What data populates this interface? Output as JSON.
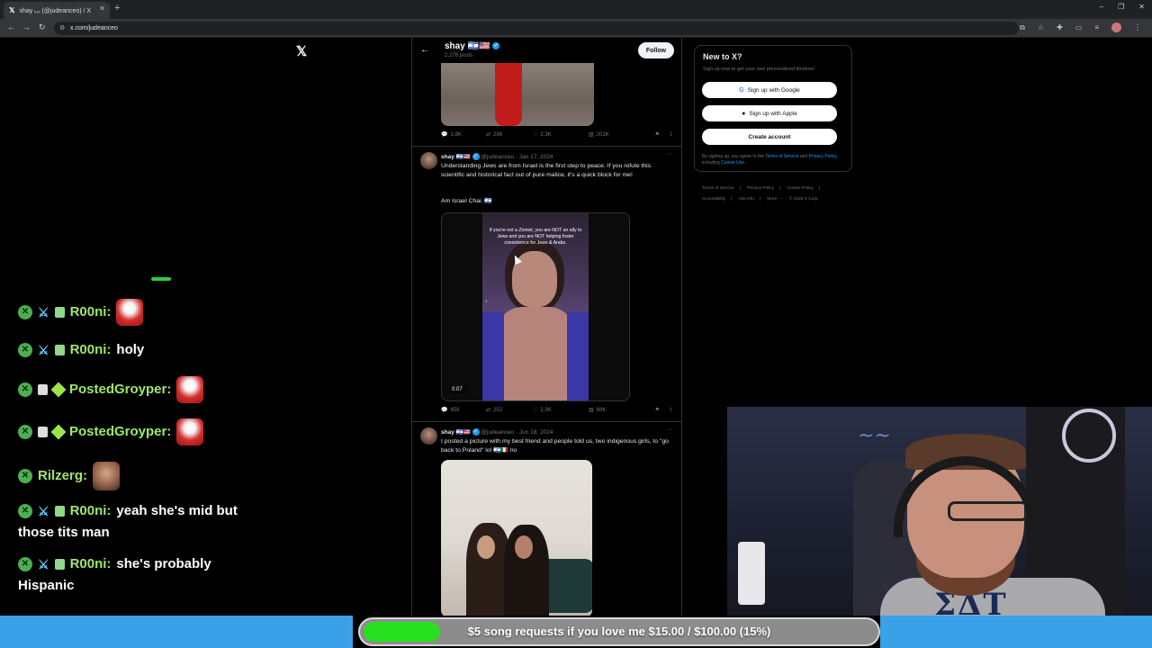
{
  "browser": {
    "tab_title": "shay ᵢᵤₛ (@judeanceo) / X",
    "tab_icon": "x-logo-icon",
    "url": "x.com/judeanceo",
    "new_tab": "+",
    "window_controls": [
      "–",
      "❐",
      "✕"
    ]
  },
  "profile_header": {
    "back": "←",
    "name": "shay 🇮🇱🇺🇸",
    "posts": "2,276 posts",
    "follow": "Follow"
  },
  "post0": {
    "metrics": {
      "replies": "1.8K",
      "reposts": "298",
      "likes": "2.3K",
      "views": "201K"
    }
  },
  "post1": {
    "name": "shay 🇮🇱🇺🇸",
    "handle": "@judeanceo",
    "date": "· Jan 17, 2024",
    "more": "···",
    "text1": "Understanding Jews are from Israel is the first step to peace. If you refute this scientific and historical fact out of pure malice, it's a quick block for me!",
    "text2": "Am Israel Chai. 🇮🇱",
    "video_caption": "If you're not a Zionist, you are NOT an ally to Jews and you are NOT helping foster coexistence for Jews & Arabs.",
    "video_time": "0:07",
    "metrics": {
      "replies": "659",
      "reposts": "252",
      "likes": "2.3K",
      "views": "68K"
    }
  },
  "post2": {
    "name": "shay 🇮🇱🇺🇸",
    "handle": "@judeanceo",
    "date": "· Jun 18, 2024",
    "more": "···",
    "text": "I posted a picture with my best friend and people told us, two indigenous girls, to \"go back to Poland\" lol 🇮🇱🇮🇹 no"
  },
  "signup": {
    "title": "New to X?",
    "subtitle": "Sign up now to get your own personalized timeline!",
    "google": "Sign up with Google",
    "apple": "Sign up with Apple",
    "create": "Create account",
    "terms_prefix": "By signing up, you agree to the",
    "terms_link": "Terms of Service",
    "and": "and",
    "privacy_link": "Privacy Policy",
    "including": ", including",
    "cookie_link": "Cookie Use."
  },
  "footer": [
    "Terms of Service",
    "|",
    "Privacy Policy",
    "|",
    "Cookie Policy",
    "|",
    "Accessibility",
    "|",
    "Ads info",
    "|",
    "More ···",
    "© 2025 X Corp."
  ],
  "chat": [
    {
      "user": "R00ni:",
      "msg": ""
    },
    {
      "user": "R00ni:",
      "msg": "holy"
    },
    {
      "user": "PostedGroyper:",
      "msg": ""
    },
    {
      "user": "PostedGroyper:",
      "msg": ""
    },
    {
      "user": "Rilzerg:",
      "msg": ""
    },
    {
      "user": "R00ni:",
      "msg": "yeah she's mid but those tits man"
    },
    {
      "user": "R00ni:",
      "msg": "she's probably Hispanic"
    }
  ],
  "goal": {
    "text": "$5 song requests if you love me $15.00 / $100.00 (15%)",
    "progress": 0.15
  }
}
